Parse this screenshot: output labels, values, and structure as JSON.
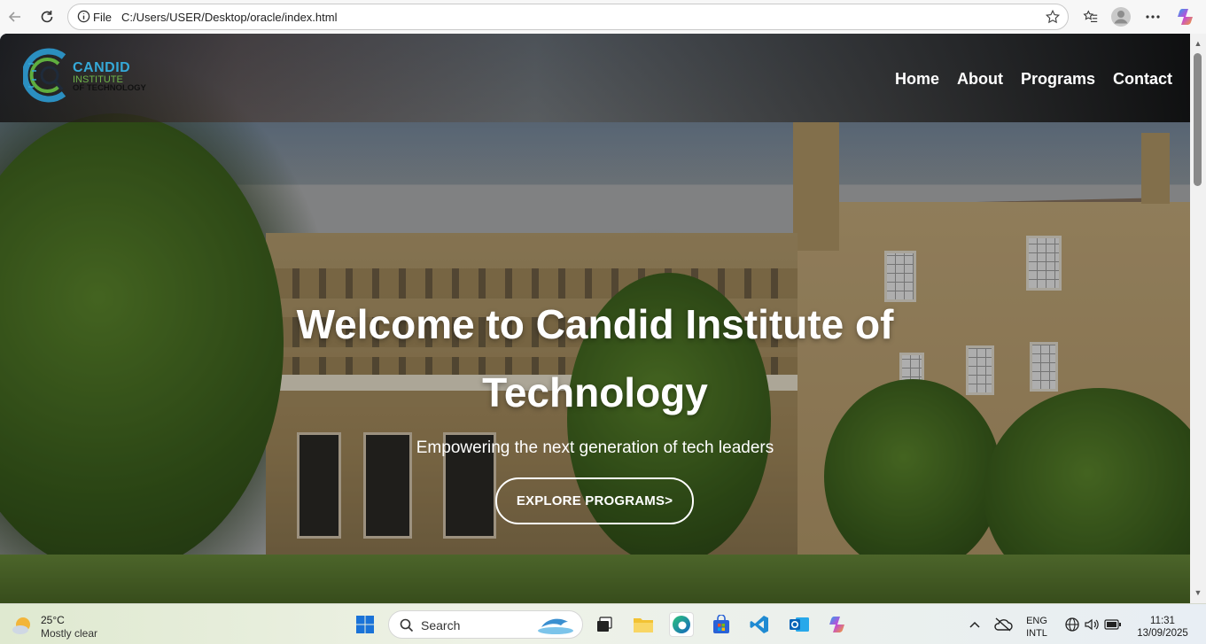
{
  "browser": {
    "scheme_label": "File",
    "url": "C:/Users/USER/Desktop/oracle/index.html"
  },
  "site": {
    "logo": {
      "line1": "CANDID",
      "line2": "INSTITUTE",
      "line3": "OF TECHNOLOGY"
    },
    "nav": [
      "Home",
      "About",
      "Programs",
      "Contact"
    ],
    "hero": {
      "title_line1": "Welcome to Candid Institute of",
      "title_line2": "Technology",
      "subtitle": "Empowering the next generation of tech leaders",
      "cta": "EXPLORE PROGRAMS>"
    }
  },
  "taskbar": {
    "weather": {
      "temp": "25°C",
      "desc": "Mostly clear"
    },
    "search_label": "Search",
    "language": {
      "line1": "ENG",
      "line2": "INTL"
    },
    "clock": {
      "time": "11:31",
      "date": "13/09/2025"
    }
  },
  "colors": {
    "accent_blue": "#35a9d8",
    "accent_green": "#6fb44a"
  }
}
